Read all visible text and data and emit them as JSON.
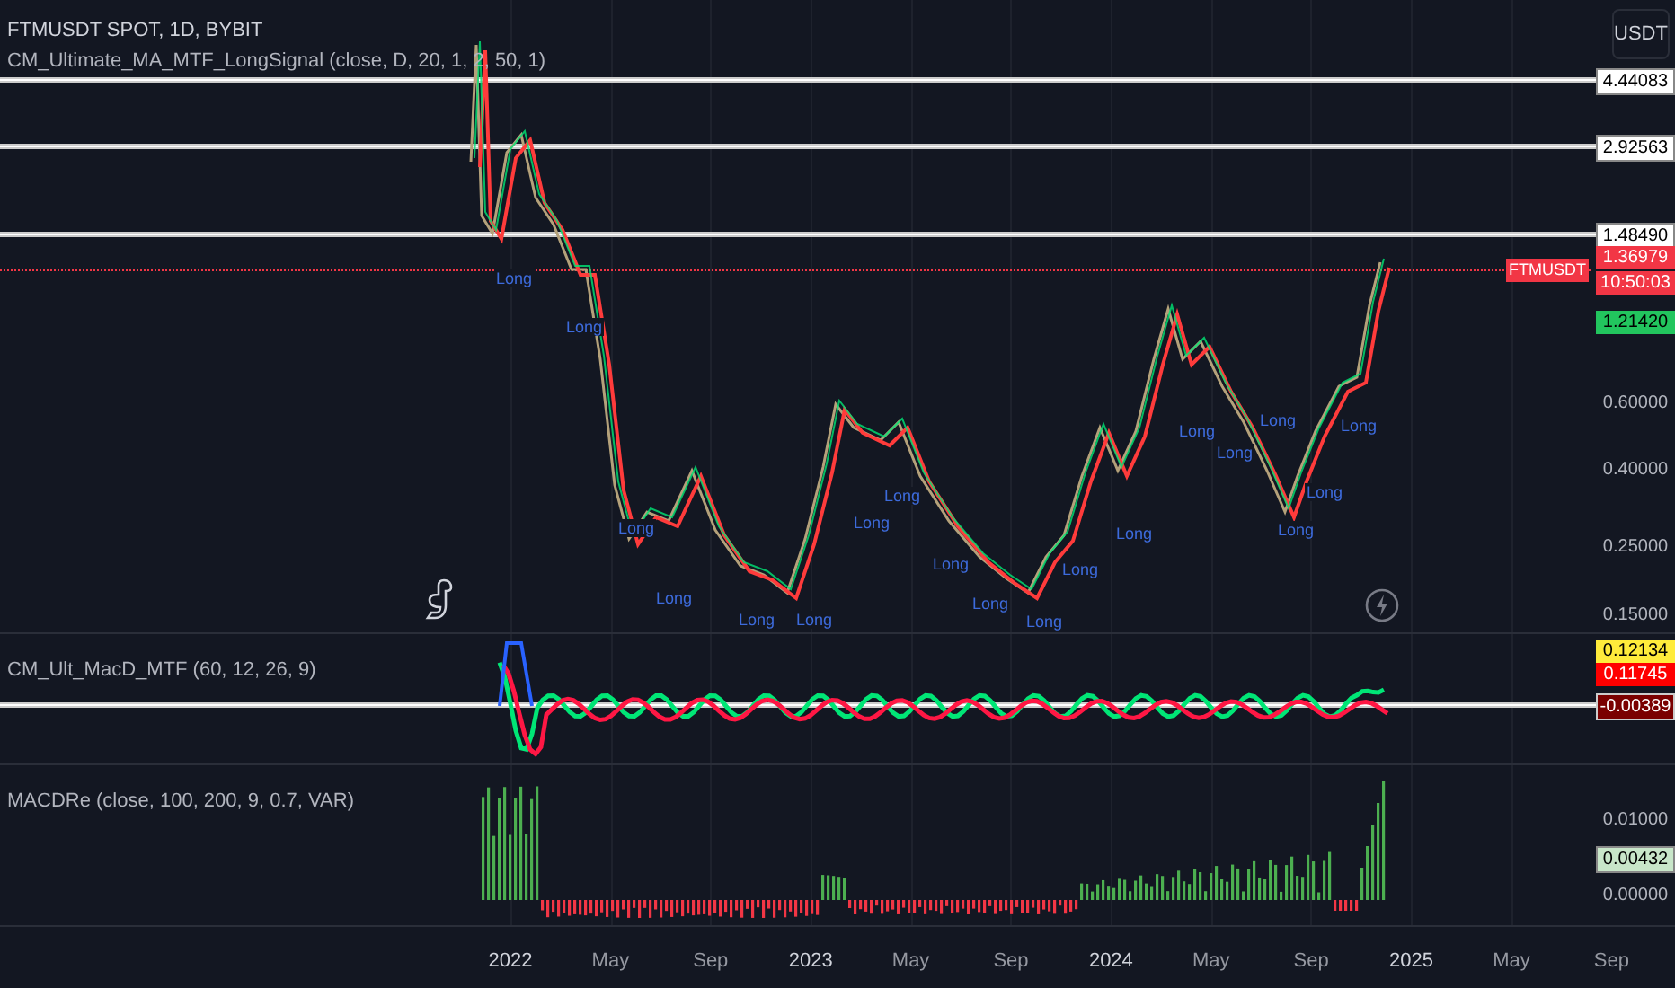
{
  "legend": {
    "title": "FTMUSDT SPOT, 1D, BYBIT",
    "indicator": "CM_Ultimate_MA_MTF_LongSignal (close, D, 20, 1, 2, 50, 1)"
  },
  "currency_button": "USDT",
  "symbol_tag": "FTMUSDT",
  "price_axis": [
    {
      "text": "4.44083",
      "kind": "level",
      "line": true
    },
    {
      "text": "2.92563",
      "kind": "level",
      "line": true
    },
    {
      "text": "1.48490",
      "kind": "level",
      "line": true
    },
    {
      "text": "1.36979",
      "kind": "last",
      "line": false
    },
    {
      "text": "10:50:03",
      "kind": "last",
      "line": false
    },
    {
      "text": "1.21420",
      "kind": "green",
      "line": false
    },
    {
      "text": "0.60000",
      "kind": "tick",
      "line": false
    },
    {
      "text": "0.40000",
      "kind": "tick",
      "line": false
    },
    {
      "text": "0.25000",
      "kind": "tick",
      "line": false
    },
    {
      "text": "0.15000",
      "kind": "tick",
      "line": false
    }
  ],
  "signals": [
    "Long",
    "Long",
    "Long",
    "Long",
    "Long",
    "Long",
    "Long",
    "Long",
    "Long",
    "Long",
    "Long",
    "Long",
    "Long",
    "Long",
    "Long",
    "Long",
    "Long",
    "Long",
    "Long"
  ],
  "macd_pane": {
    "label": "CM_Ult_MacD_MTF (60, 12, 26, 9)",
    "axis": [
      {
        "text": "0.12134",
        "kind": "yellow",
        "line": false
      },
      {
        "text": "0.11745",
        "kind": "red",
        "line": false
      },
      {
        "text": "-0.00389",
        "kind": "darkred",
        "line": true
      }
    ]
  },
  "macdre_pane": {
    "label": "MACDRe (close, 100, 200, 9, 0.7, VAR)",
    "axis": [
      {
        "text": "0.01000",
        "kind": "tick",
        "line": false
      },
      {
        "text": "0.00432",
        "kind": "mint",
        "line": false
      },
      {
        "text": "0.00000",
        "kind": "tick",
        "line": false
      }
    ]
  },
  "time_axis": [
    {
      "text": "2022",
      "kind": "year"
    },
    {
      "text": "May",
      "kind": "month"
    },
    {
      "text": "Sep",
      "kind": "month"
    },
    {
      "text": "2023",
      "kind": "year"
    },
    {
      "text": "May",
      "kind": "month"
    },
    {
      "text": "Sep",
      "kind": "month"
    },
    {
      "text": "2024",
      "kind": "year"
    },
    {
      "text": "May",
      "kind": "month"
    },
    {
      "text": "Sep",
      "kind": "month"
    },
    {
      "text": "2025",
      "kind": "year"
    },
    {
      "text": "May",
      "kind": "month"
    },
    {
      "text": "Sep",
      "kind": "month"
    }
  ]
}
